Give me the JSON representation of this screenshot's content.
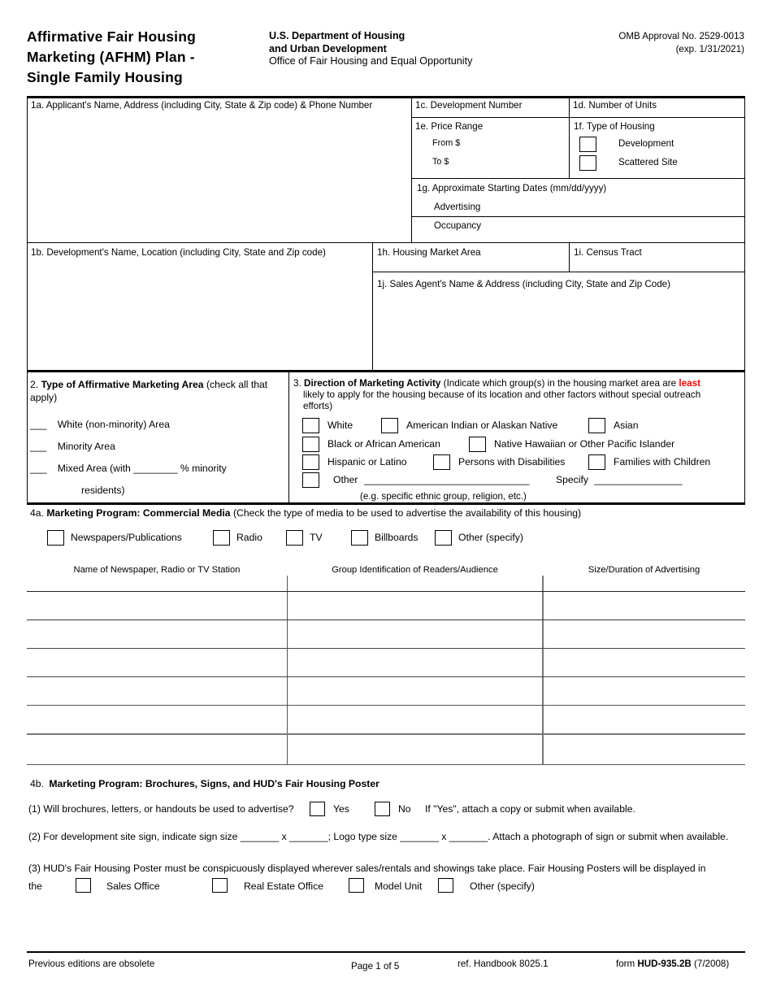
{
  "header": {
    "title_lines": [
      "Affirmative  Fair  Housing",
      "Marketing (AFHM) Plan -",
      "Single  Family  Housing"
    ],
    "dept_line1": "U.S. Department of Housing",
    "dept_line2": "and Urban Development",
    "dept_line3": "Office of Fair Housing and Equal Opportunity",
    "omb_line1": "OMB Approval No. 2529-0013",
    "omb_line2": "(exp.  1/31/2021)"
  },
  "section1": {
    "a_label": "1a. Applicant's Name, Address (including City, State & Zip code) & Phone Number",
    "b_label": "1b.  Development's Name, Location (including City, State and Zip code)",
    "c_label": "1c.  Development Number",
    "d_label": "1d.  Number of Units",
    "e_label": "1e.  Price Range",
    "e_from": "From $",
    "e_to": "To $",
    "f_label": "1f.  Type of Housing",
    "f_options": [
      "Development",
      "Scattered Site"
    ],
    "g_label": "1g.  Approximate Starting Dates (mm/dd/yyyy)",
    "g_advertising": "Advertising",
    "g_occupancy": "Occupancy",
    "h_label": "1h.  Housing Market Area",
    "i_label": "1i.  Census Tract",
    "j_label": "1j.  Sales Agent's Name & Address  (including  City, State and Zip Code)"
  },
  "section2": {
    "number": "2.",
    "title": "Type of Affirmative Marketing Area",
    "instruction": "(check all that apply)",
    "options": [
      "White (non-minority) Area",
      "Minority Area"
    ],
    "mixed_prefix": "Mixed Area (with",
    "mixed_blank": "________",
    "mixed_suffix": "% minority",
    "mixed_second_line": "residents)",
    "dash": "___"
  },
  "section3": {
    "number": "3.",
    "title": "Direction of Marketing Activity",
    "instr_part1": "(Indicate which group(s) in the housing market area are",
    "instr_emph": "least",
    "instr_part2": "likely to apply for the housing because of its location and other factors without special outreach",
    "instr_part3": "efforts)",
    "row1": [
      "White",
      "American Indian or Alaskan Native",
      "Asian"
    ],
    "row2": [
      "Black or African American",
      "Native Hawaiian or Other Pacific Islander"
    ],
    "row3": [
      "Hispanic or Latino",
      "Persons with Disabilities",
      "Families with Children"
    ],
    "other_label": "Other",
    "other_blank": "______________________________",
    "specify_label": "Specify",
    "specify_blank": "________________",
    "other_note": "(e.g. specific ethnic group, religion, etc.)"
  },
  "section4a": {
    "number": "4a.",
    "title": "Marketing Program: Commercial Media",
    "instruction": "(Check the type of media to be used to advertise the availability of this housing)",
    "media": [
      "Newspapers/Publications",
      "Radio",
      "TV",
      "Billboards",
      "Other (specify)"
    ],
    "columns": [
      "Name of Newspaper, Radio or TV Station",
      "Group Identification of Readers/Audience",
      "Size/Duration of Advertising"
    ],
    "row_count": 6
  },
  "section4b": {
    "number": "4b.",
    "title": "Marketing Program: Brochures, Signs, and HUD's Fair Housing Poster",
    "q1_prefix": "(1) Will brochures, letters, or handouts be used to advertise?",
    "q1_yes": "Yes",
    "q1_no": "No",
    "q1_suffix": "If \"Yes\", attach a copy or submit when available.",
    "q2_part1": "(2) For development site sign, indicate sign size",
    "q2_blank1": "_______",
    "q2_x1": "x",
    "q2_blank2": "_______",
    "q2_part2": "; Logo  type size",
    "q2_blank3": "_______",
    "q2_x2": "x",
    "q2_blank4": "_______",
    "q2_part3": ".  Attach a photograph of sign or submit when available.",
    "q3_text": "(3) HUD's Fair Housing Poster must be conspicuously displayed wherever sales/rentals and showings take place.  Fair Housing Posters will be displayed in",
    "q3_the": "the",
    "q3_options": [
      "Sales Office",
      "Real Estate Office",
      "Model Unit",
      "Other (specify)"
    ]
  },
  "footer": {
    "left": "Previous editions are obsolete",
    "page": "Page 1 of 5",
    "ref": "ref. Handbook 8025.1",
    "form_prefix": "form",
    "form_code": "HUD-935.2B",
    "form_date": "(7/2008)"
  }
}
